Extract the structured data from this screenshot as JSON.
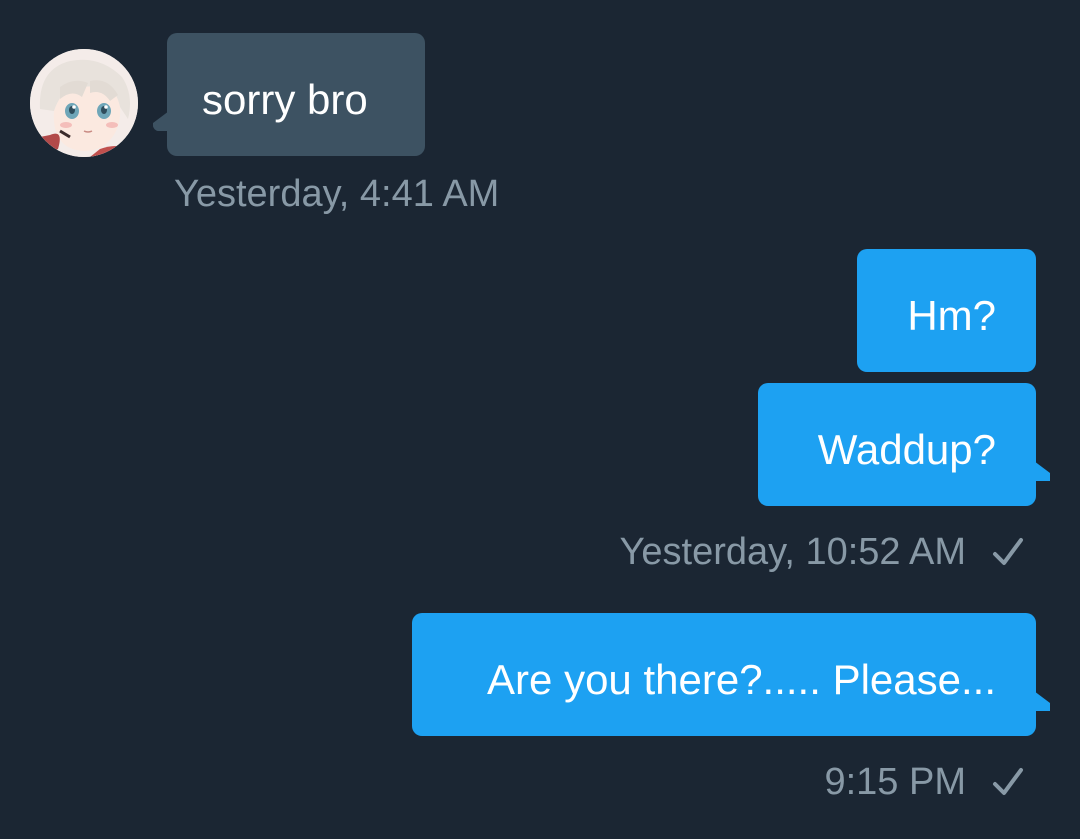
{
  "conversation": {
    "messages": [
      {
        "direction": "incoming",
        "text": "sorry bro",
        "timestamp": "Yesterday, 4:41 AM"
      },
      {
        "direction": "outgoing",
        "text": "Hm?"
      },
      {
        "direction": "outgoing",
        "text": "Waddup?",
        "timestamp": "Yesterday, 10:52 AM",
        "status_icon": "check-icon"
      },
      {
        "direction": "outgoing",
        "text": "Are you there?..... Please...",
        "timestamp": "9:15 PM",
        "status_icon": "check-icon"
      }
    ]
  },
  "colors": {
    "background": "#1b2633",
    "incoming_bubble": "#3d5262",
    "outgoing_bubble": "#1da1f2",
    "meta_text": "#8899a6",
    "message_text": "#ffffff"
  },
  "avatar": {
    "icon": "avatar-anime-girl"
  }
}
